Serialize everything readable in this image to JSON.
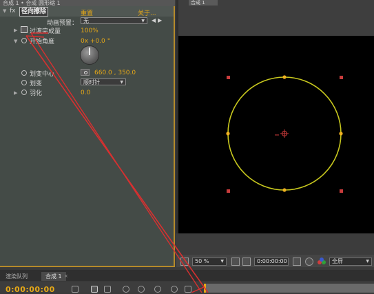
{
  "effect_panel": {
    "title_partial": "合成 1 • 合成 圆形缩 1",
    "effect_name": "径向擦除",
    "reset_label": "重置",
    "about_label": "关于...",
    "anim_preset_label": "动画预置：",
    "anim_preset_value": "无",
    "transition_completion_label": "过渡完成量",
    "transition_completion_value": "100%",
    "start_angle_label": "开始角度",
    "start_angle_value": "0x +0.0 °",
    "wipe_center_label": "划变中心",
    "wipe_center_value": "660.0 , 350.0",
    "wipe_label": "划变",
    "wipe_value": "顺时针",
    "feather_label": "羽化",
    "feather_value": "0.0"
  },
  "viewer": {
    "comp_tab": "合成 1",
    "zoom": "50 %",
    "timecode": "0:00:00:00",
    "view_label": "全屏"
  },
  "timeline": {
    "tab_render_queue": "渲染队列",
    "tab_comp": "合成 1",
    "timecode": "0:00:00:00"
  },
  "colors": {
    "accent_orange": "#e6a817",
    "circle_stroke": "#c8c81e",
    "marker_red": "#d03c3c",
    "annotation_red": "#d83030"
  }
}
